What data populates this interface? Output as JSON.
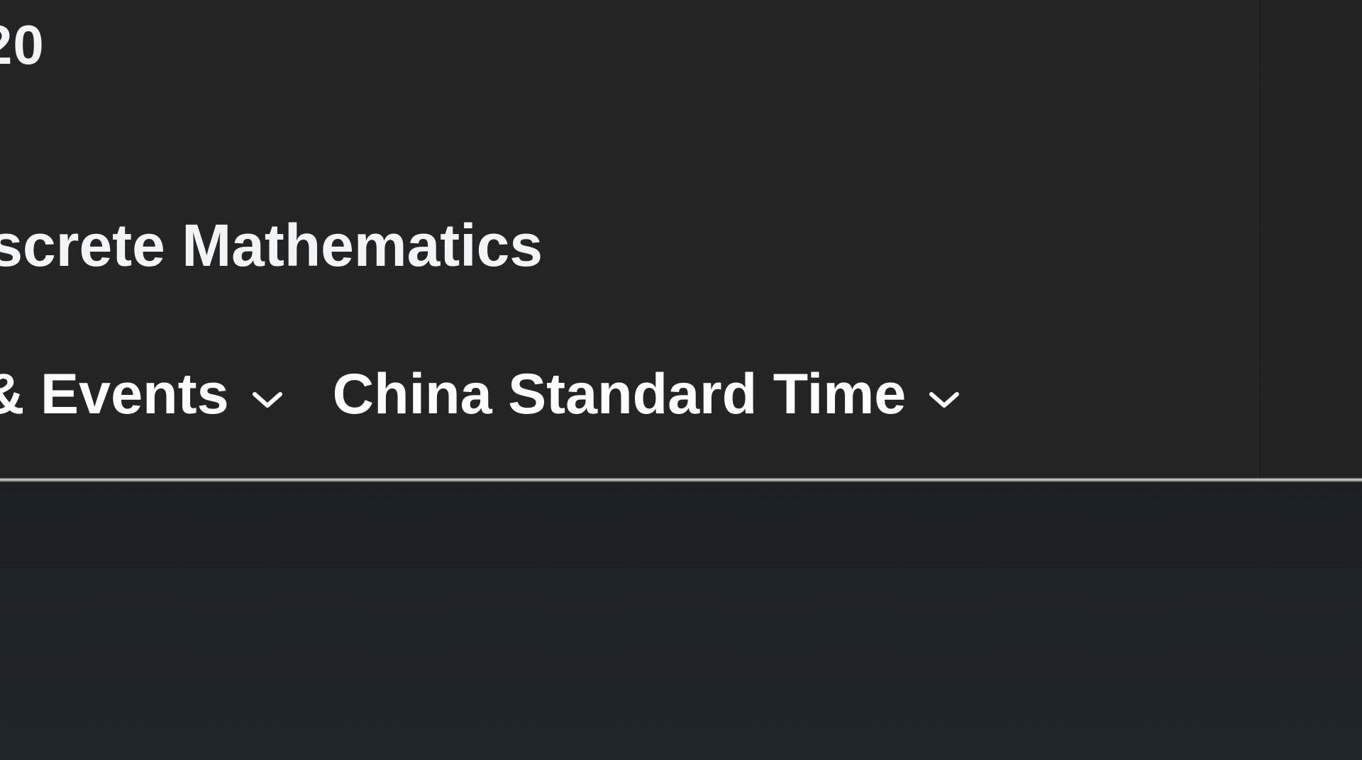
{
  "header": {
    "year_fragment": "20",
    "course_title_fragment": "iscrete Mathematics"
  },
  "filters": {
    "events_label_fragment": "& Events",
    "events_icon": "chevron-down-icon",
    "timezone_label": "China Standard Time",
    "timezone_icon": "chevron-down-icon"
  }
}
